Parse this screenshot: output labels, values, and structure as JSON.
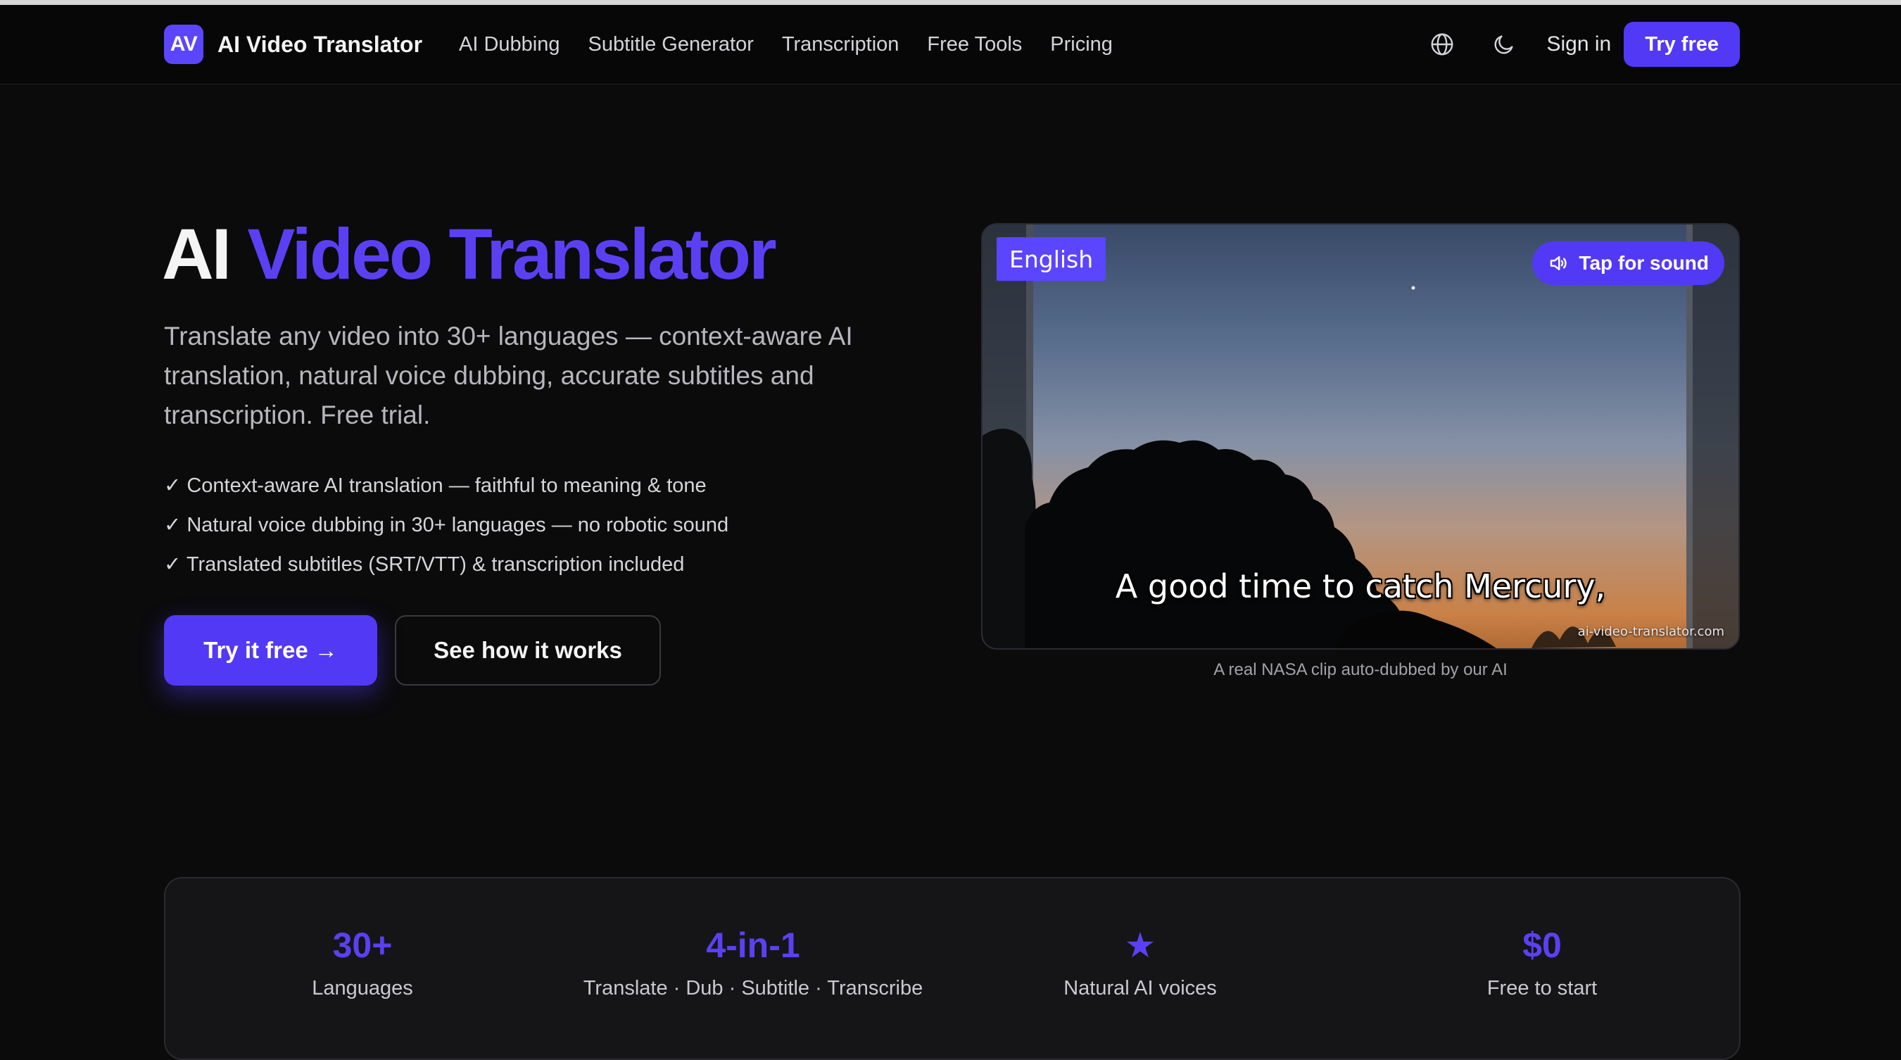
{
  "colors": {
    "accent": "#5239f5",
    "accent_text": "#5b40f3",
    "background": "#0b0b0c"
  },
  "nav": {
    "logo_text": "AV",
    "brand_name": "AI Video Translator",
    "links": [
      "AI Dubbing",
      "Subtitle Generator",
      "Transcription",
      "Free Tools",
      "Pricing"
    ],
    "language_icon": "globe-icon",
    "theme_icon": "moon-icon",
    "sign_in": "Sign in",
    "try_free": "Try free"
  },
  "hero": {
    "title_part1": "AI",
    "title_part2": "Video Translator",
    "subtitle": "Translate any video into 30+ languages — context-aware AI translation, natural voice dubbing, accurate subtitles and transcription. Free trial.",
    "features": [
      "✓ Context-aware AI translation — faithful to meaning & tone",
      "✓ Natural voice dubbing in 30+ languages — no robotic sound",
      "✓ Translated subtitles (SRT/VTT) & transcription included"
    ],
    "cta_primary": "Try it free →",
    "cta_secondary": "See how it works"
  },
  "video": {
    "language_badge": "English",
    "sound_button": "Tap for sound",
    "sound_icon": "speaker-icon",
    "subtitle": "A good time to catch Mercury,",
    "watermark": "ai-video-translator.com",
    "caption": "A real NASA clip auto-dubbed by our AI"
  },
  "stats": [
    {
      "value": "30+",
      "label": "Languages"
    },
    {
      "value": "4-in-1",
      "label": "Translate · Dub · Subtitle · Transcribe"
    },
    {
      "value": "★",
      "label": "Natural AI voices"
    },
    {
      "value": "$0",
      "label": "Free to start"
    }
  ]
}
